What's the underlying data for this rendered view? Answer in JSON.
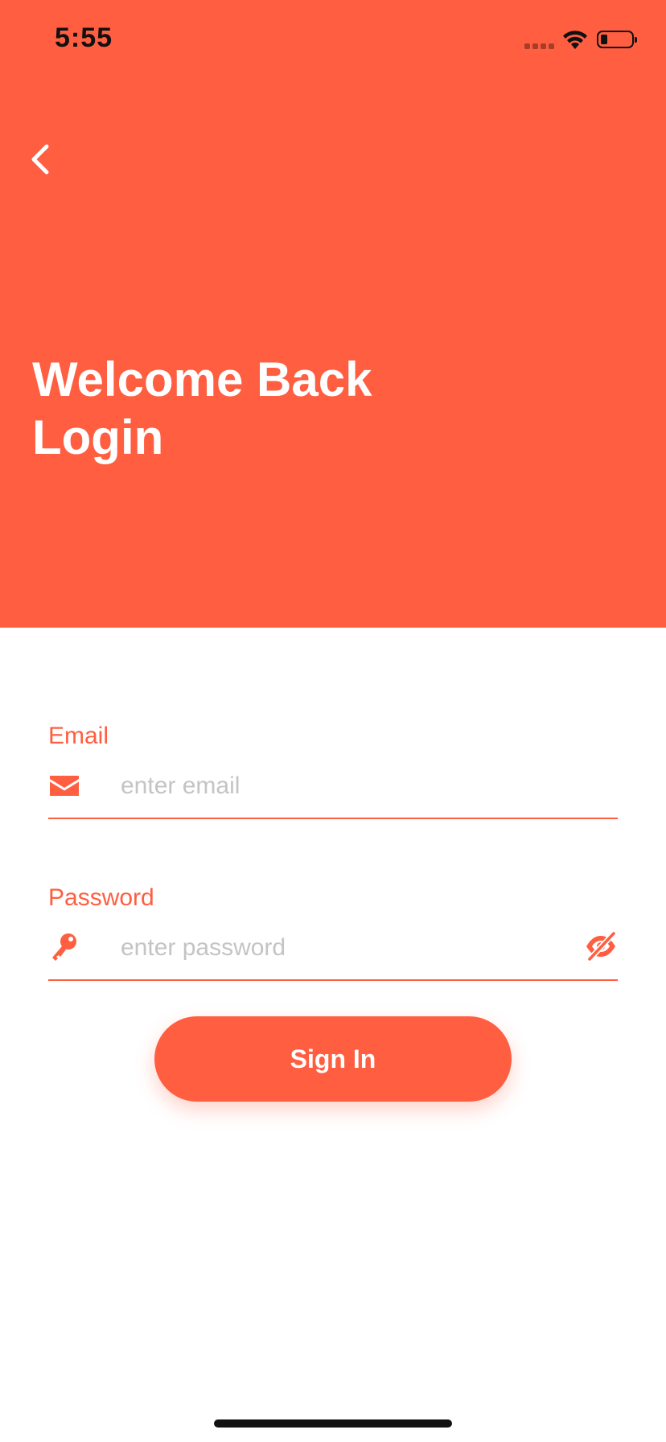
{
  "status_bar": {
    "time": "5:55",
    "icons": [
      "signal-icon",
      "wifi-icon",
      "battery-icon"
    ]
  },
  "header": {
    "back_icon": "chevron-left-icon",
    "title_line1": "Welcome Back",
    "title_line2": "Login"
  },
  "form": {
    "email": {
      "label": "Email",
      "placeholder": "enter email",
      "value": "",
      "icon": "envelope-icon"
    },
    "password": {
      "label": "Password",
      "placeholder": "enter password",
      "value": "",
      "icon": "key-icon",
      "toggle_icon": "eye-slash-icon"
    },
    "submit_label": "Sign In"
  },
  "colors": {
    "primary": "#FF5E40",
    "background": "#FFFFFF",
    "placeholder": "#C4C4C6"
  }
}
